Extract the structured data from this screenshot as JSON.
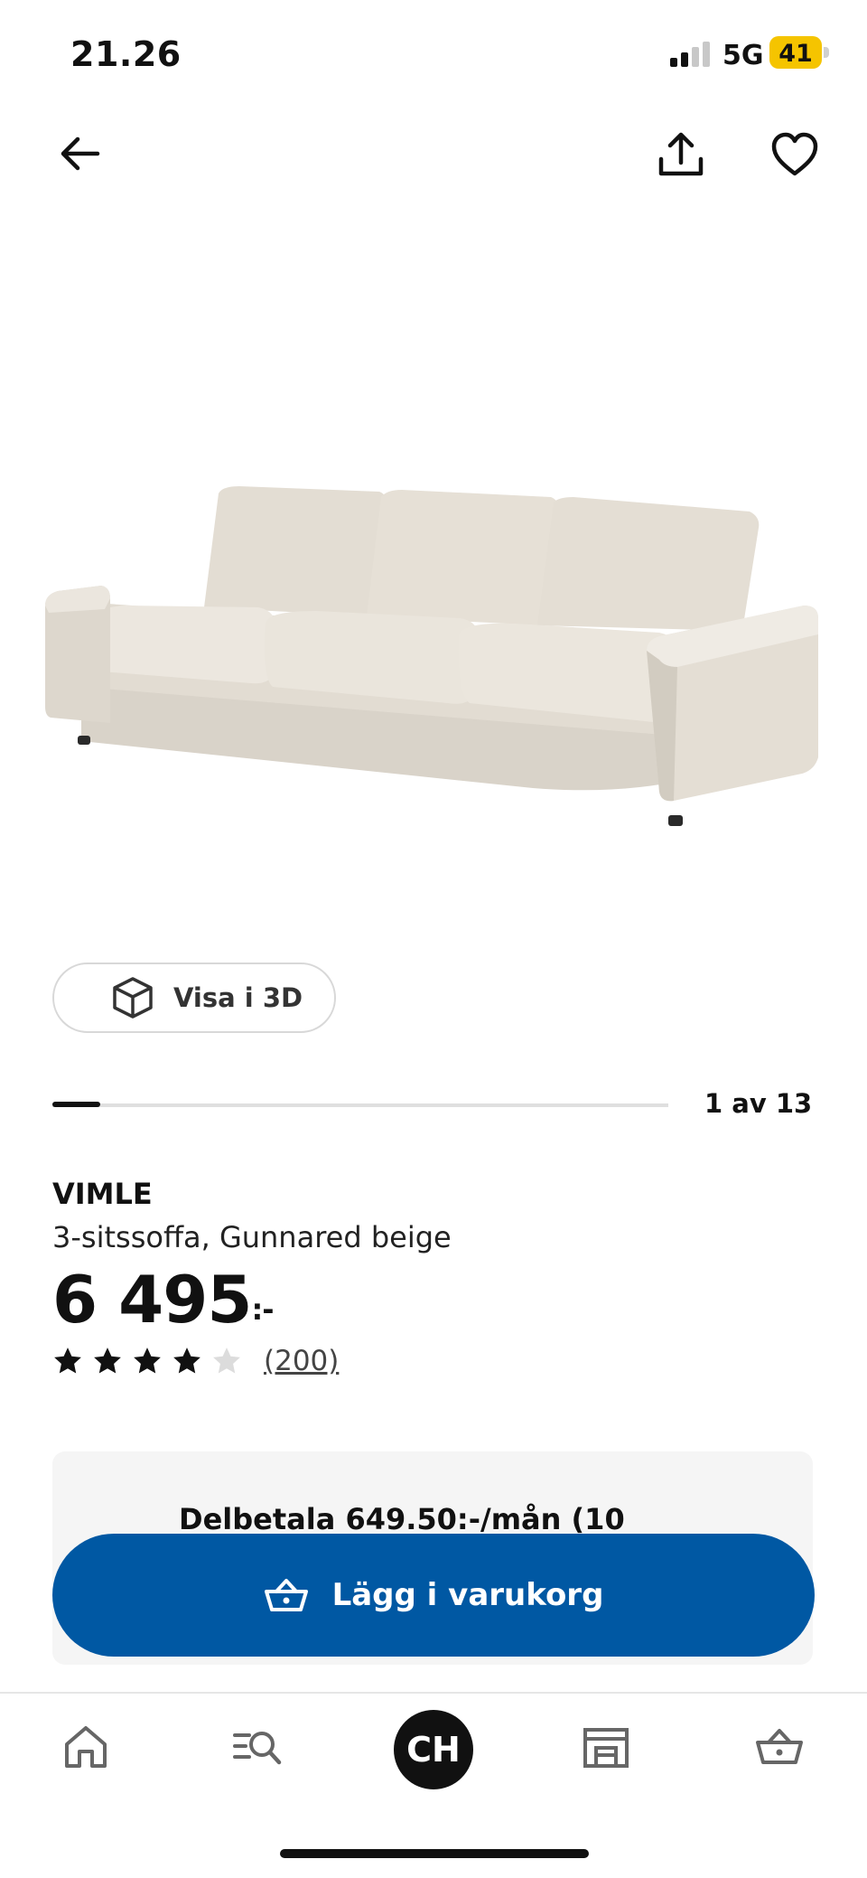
{
  "status_bar": {
    "time": "21.26",
    "network": "5G",
    "battery": "41"
  },
  "header": {
    "back_icon": "arrow-left-icon",
    "share_icon": "share-icon",
    "favorite_icon": "heart-icon"
  },
  "gallery": {
    "view_3d_label": "Visa i 3D",
    "page_indicator": "1 av 13",
    "progress": 0.077
  },
  "product": {
    "name": "VIMLE",
    "description": "3-sitssoffa, Gunnared beige",
    "price": "6 495",
    "price_suffix": ":-",
    "rating": 4,
    "rating_max": 5,
    "review_count": "(200)"
  },
  "installment": {
    "text": "Delbetala 649.50:-/mån (10"
  },
  "cart_button": {
    "label": "Lägg i varukorg"
  },
  "bottom_nav": {
    "avatar_initials": "CH",
    "items": [
      "home-icon",
      "search-icon",
      "avatar",
      "store-icon",
      "cart-icon"
    ]
  },
  "colors": {
    "primary": "#0058a3",
    "sofa": "#e7e2da",
    "battery": "#f5c400"
  }
}
